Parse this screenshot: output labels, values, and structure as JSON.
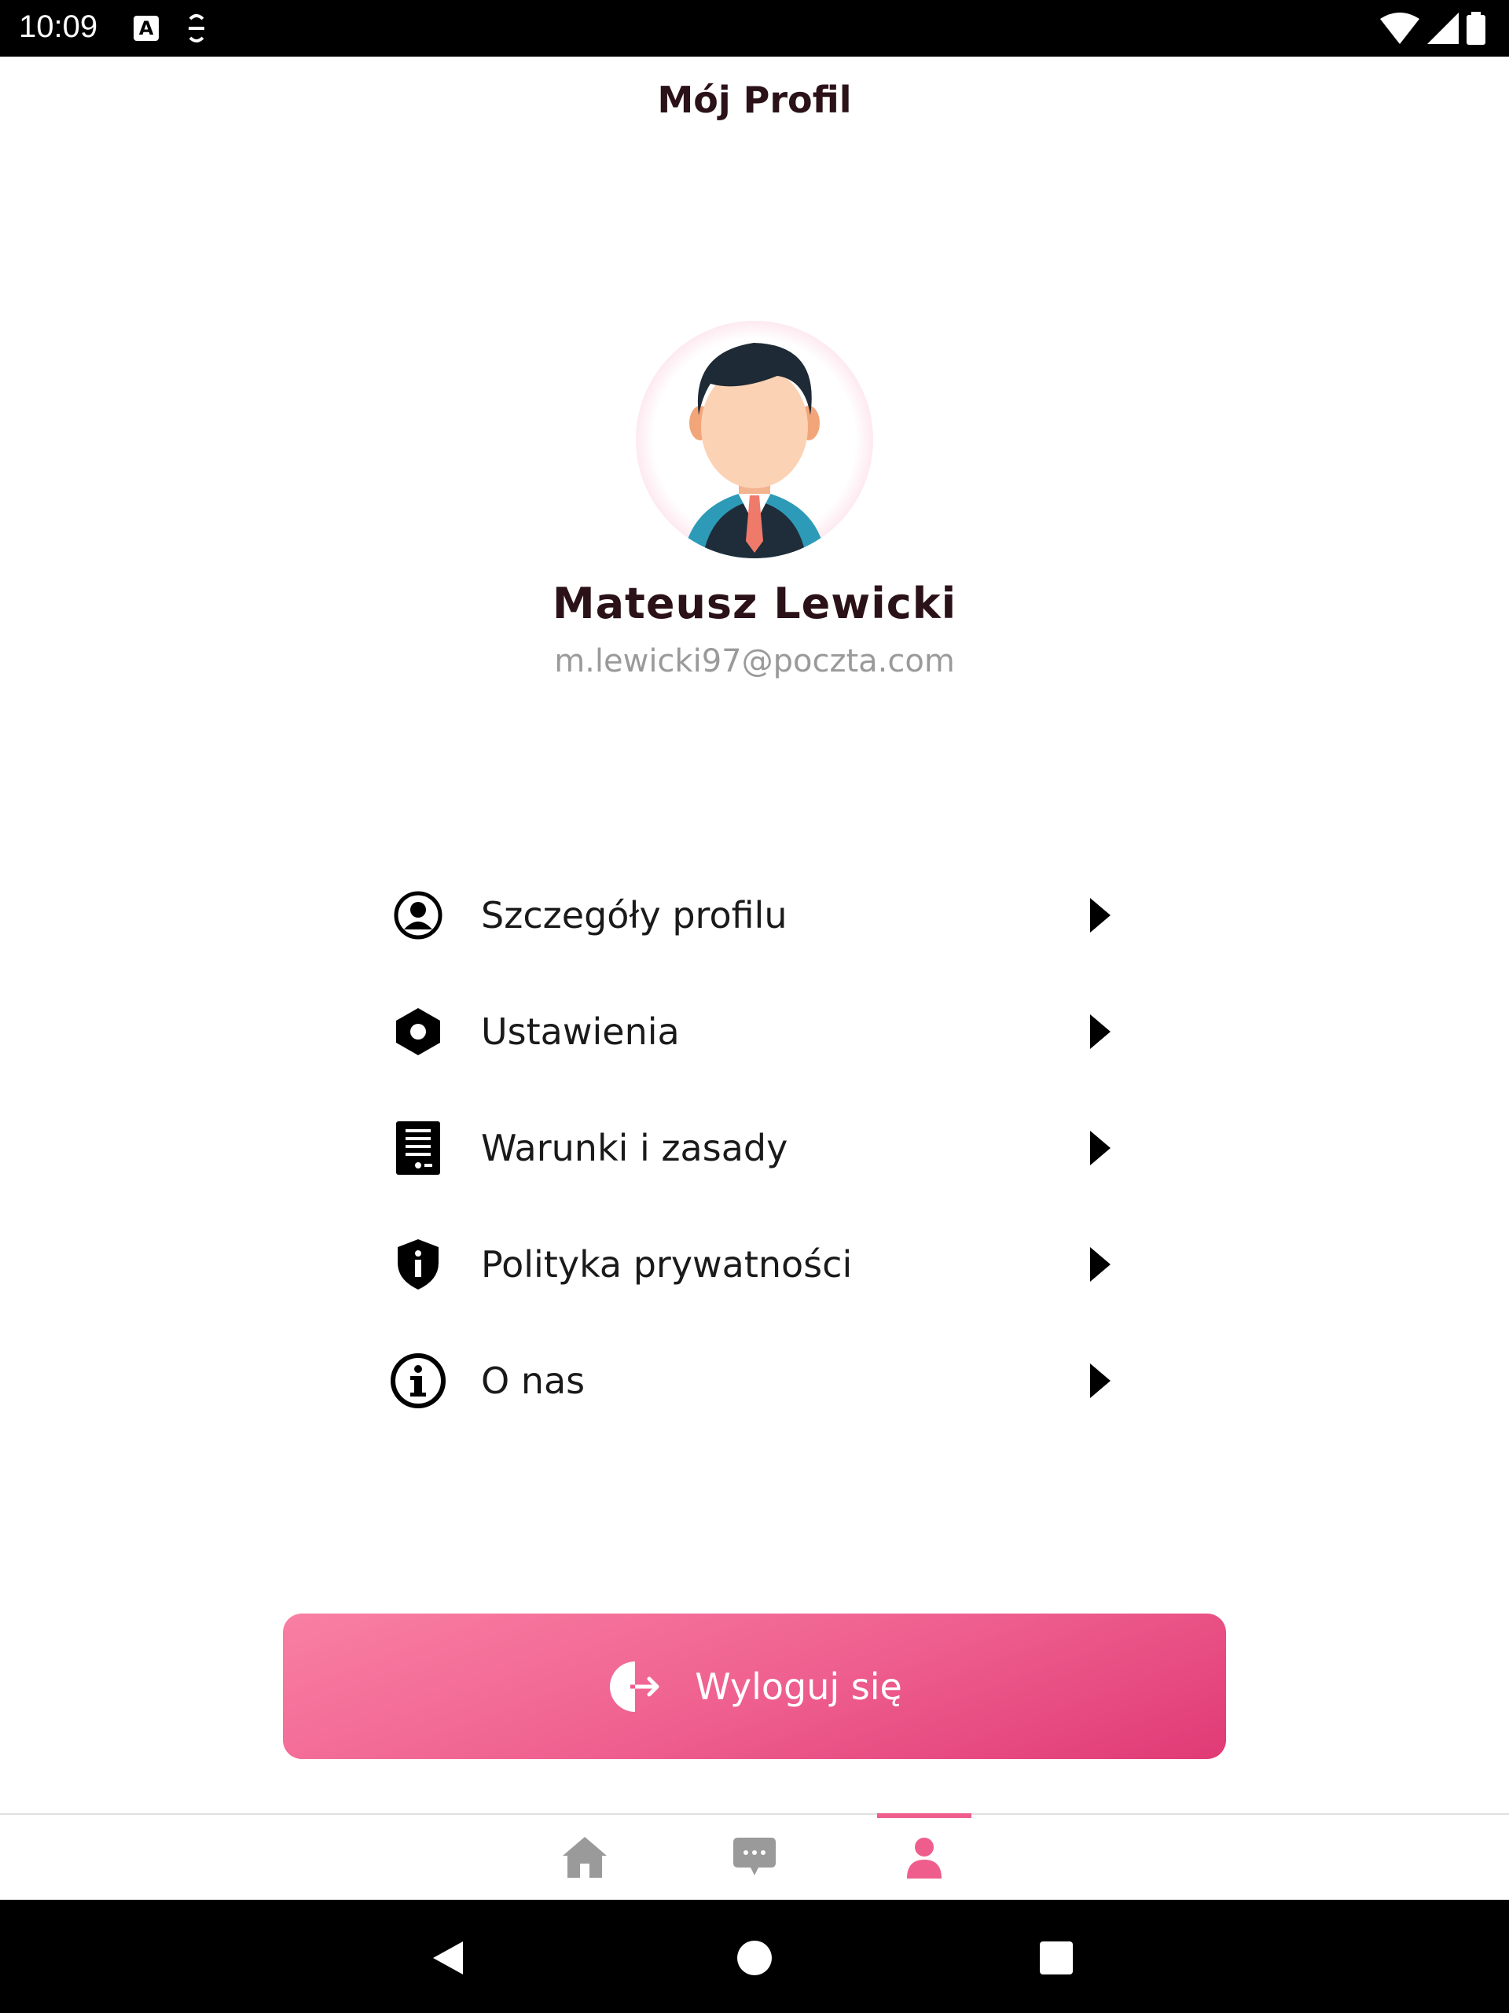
{
  "status_bar": {
    "time": "10:09",
    "icons": [
      "a-badge-icon",
      "s-badge-icon",
      "wifi-icon",
      "signal-icon",
      "battery-icon"
    ]
  },
  "header": {
    "title": "Mój Profil"
  },
  "profile": {
    "name": "Mateusz Lewicki",
    "email": "m.lewicki97@poczta.com"
  },
  "menu": {
    "items": [
      {
        "label": "Szczegóły profilu",
        "icon": "account-circle-icon"
      },
      {
        "label": "Ustawienia",
        "icon": "settings-hexagon-icon"
      },
      {
        "label": "Warunki i zasady",
        "icon": "document-icon"
      },
      {
        "label": "Polityka prywatności",
        "icon": "shield-info-icon"
      },
      {
        "label": "O nas",
        "icon": "info-circle-icon"
      }
    ]
  },
  "logout": {
    "label": "Wyloguj się",
    "icon": "logout-icon"
  },
  "bottom_nav": {
    "items": [
      "home-icon",
      "chat-icon",
      "profile-icon"
    ],
    "active": "profile-icon"
  },
  "colors": {
    "accent": "#ef5d8c",
    "title_text": "#2b1218",
    "muted_text": "#9a9a9a",
    "button_gradient_start": "#f97fa3",
    "button_gradient_end": "#e03a75"
  }
}
